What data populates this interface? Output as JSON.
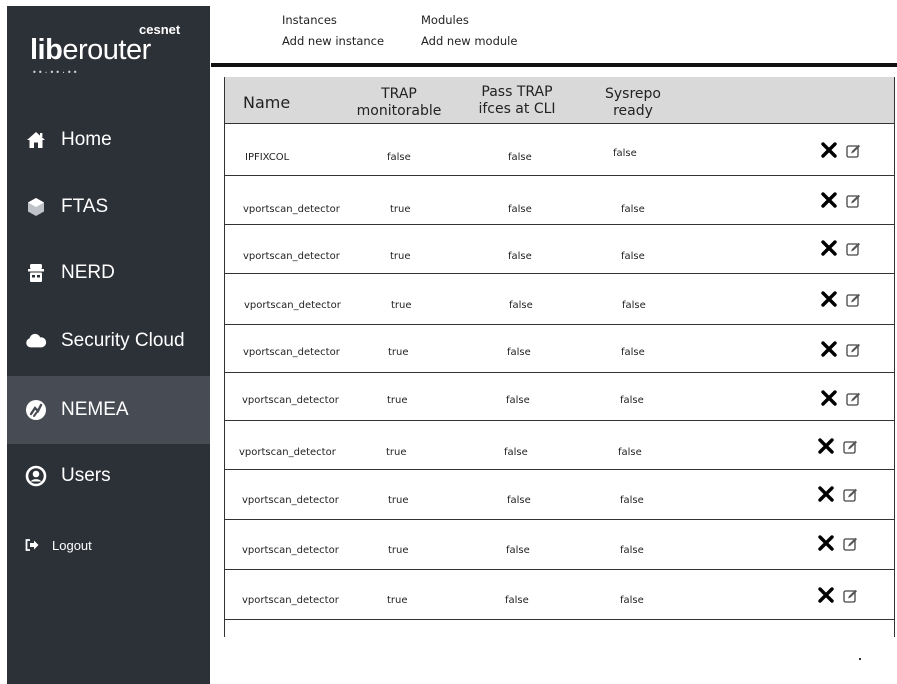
{
  "brand": {
    "small": "cesnet",
    "main_bold": "lib",
    "main_rest": "erouter",
    "dots": "••·••·••"
  },
  "sidebar": {
    "items": [
      {
        "label": "Home",
        "icon": "home-icon"
      },
      {
        "label": "FTAS",
        "icon": "hexagon-icon"
      },
      {
        "label": "NERD",
        "icon": "nerd-icon"
      },
      {
        "label": "Security Cloud",
        "icon": "cloud-icon"
      },
      {
        "label": "NEMEA",
        "icon": "nemea-icon",
        "active": true
      },
      {
        "label": "Users",
        "icon": "user-icon"
      },
      {
        "label": "Logout",
        "icon": "logout-icon"
      }
    ]
  },
  "topmenu": {
    "instances": {
      "title": "Instances",
      "action": "Add new instance"
    },
    "modules": {
      "title": "Modules",
      "action": "Add new module"
    }
  },
  "table": {
    "headers": {
      "name": "Name",
      "trap_monitorable": [
        "TRAP",
        "monitorable"
      ],
      "pass_trap": [
        "Pass TRAP",
        "ifces at CLI"
      ],
      "sysrepo": [
        "Sysrepo",
        "ready"
      ]
    },
    "rows": [
      {
        "name": "IPFIXCOL",
        "trap": "false",
        "pass": "false",
        "sysrepo": "false"
      },
      {
        "name": "vportscan_detector",
        "trap": "true",
        "pass": "false",
        "sysrepo": "false"
      },
      {
        "name": "vportscan_detector",
        "trap": "true",
        "pass": "false",
        "sysrepo": "false"
      },
      {
        "name": "vportscan_detector",
        "trap": "true",
        "pass": "false",
        "sysrepo": "false"
      },
      {
        "name": "vportscan_detector",
        "trap": "true",
        "pass": "false",
        "sysrepo": "false"
      },
      {
        "name": "vportscan_detector",
        "trap": "true",
        "pass": "false",
        "sysrepo": "false"
      },
      {
        "name": "vportscan_detector",
        "trap": "true",
        "pass": "false",
        "sysrepo": "false"
      },
      {
        "name": "vportscan_detector",
        "trap": "true",
        "pass": "false",
        "sysrepo": "false"
      },
      {
        "name": "vportscan_detector",
        "trap": "true",
        "pass": "false",
        "sysrepo": "false"
      },
      {
        "name": "vportscan_detector",
        "trap": "true",
        "pass": "false",
        "sysrepo": "false"
      }
    ],
    "row_actions": {
      "delete_icon": "close-icon",
      "edit_icon": "edit-icon"
    }
  },
  "colors": {
    "sidebar_bg": "#2c3037",
    "sidebar_active": "#474c54",
    "header_bg": "#d9d9d9"
  }
}
